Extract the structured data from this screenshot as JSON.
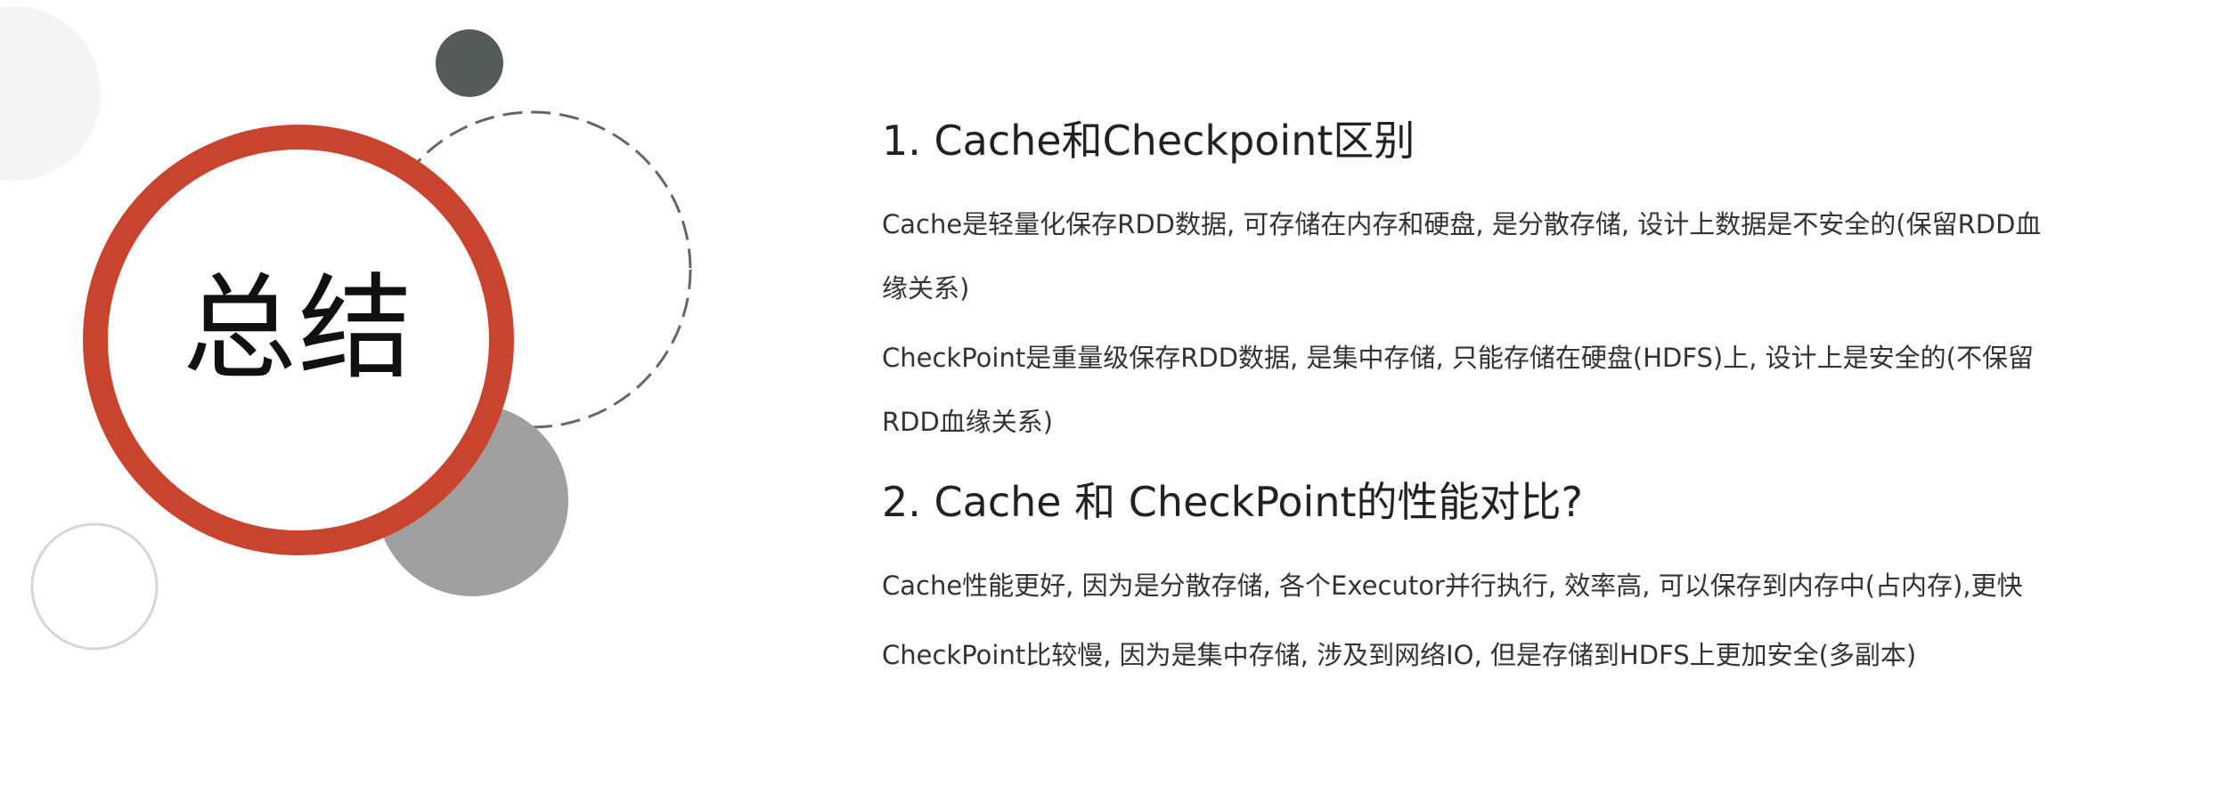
{
  "slide": {
    "summary_title": "总结",
    "sections": [
      {
        "heading": "1. Cache和Checkpoint区别",
        "paragraphs": [
          "Cache是轻量化保存RDD数据, 可存储在内存和硬盘, 是分散存储, 设计上数据是不安全的(保留RDD血缘关系)",
          "CheckPoint是重量级保存RDD数据, 是集中存储, 只能存储在硬盘(HDFS)上, 设计上是安全的(不保留RDD血缘关系)"
        ]
      },
      {
        "heading": "2. Cache 和 CheckPoint的性能对比?",
        "paragraphs": [
          "Cache性能更好, 因为是分散存储, 各个Executor并行执行, 效率高, 可以保存到内存中(占内存),更快",
          "CheckPoint比较慢, 因为是集中存储, 涉及到网络IO, 但是存储到HDFS上更加安全(多副本)"
        ]
      }
    ]
  },
  "colors": {
    "ring_red": "#c8442f",
    "dark_dot": "#555b58",
    "gray_circle": "#a0a0a0",
    "light_circle": "#f4f4f4",
    "outline_circle": "#d6d6d6",
    "dashed_circle": "#666666"
  }
}
